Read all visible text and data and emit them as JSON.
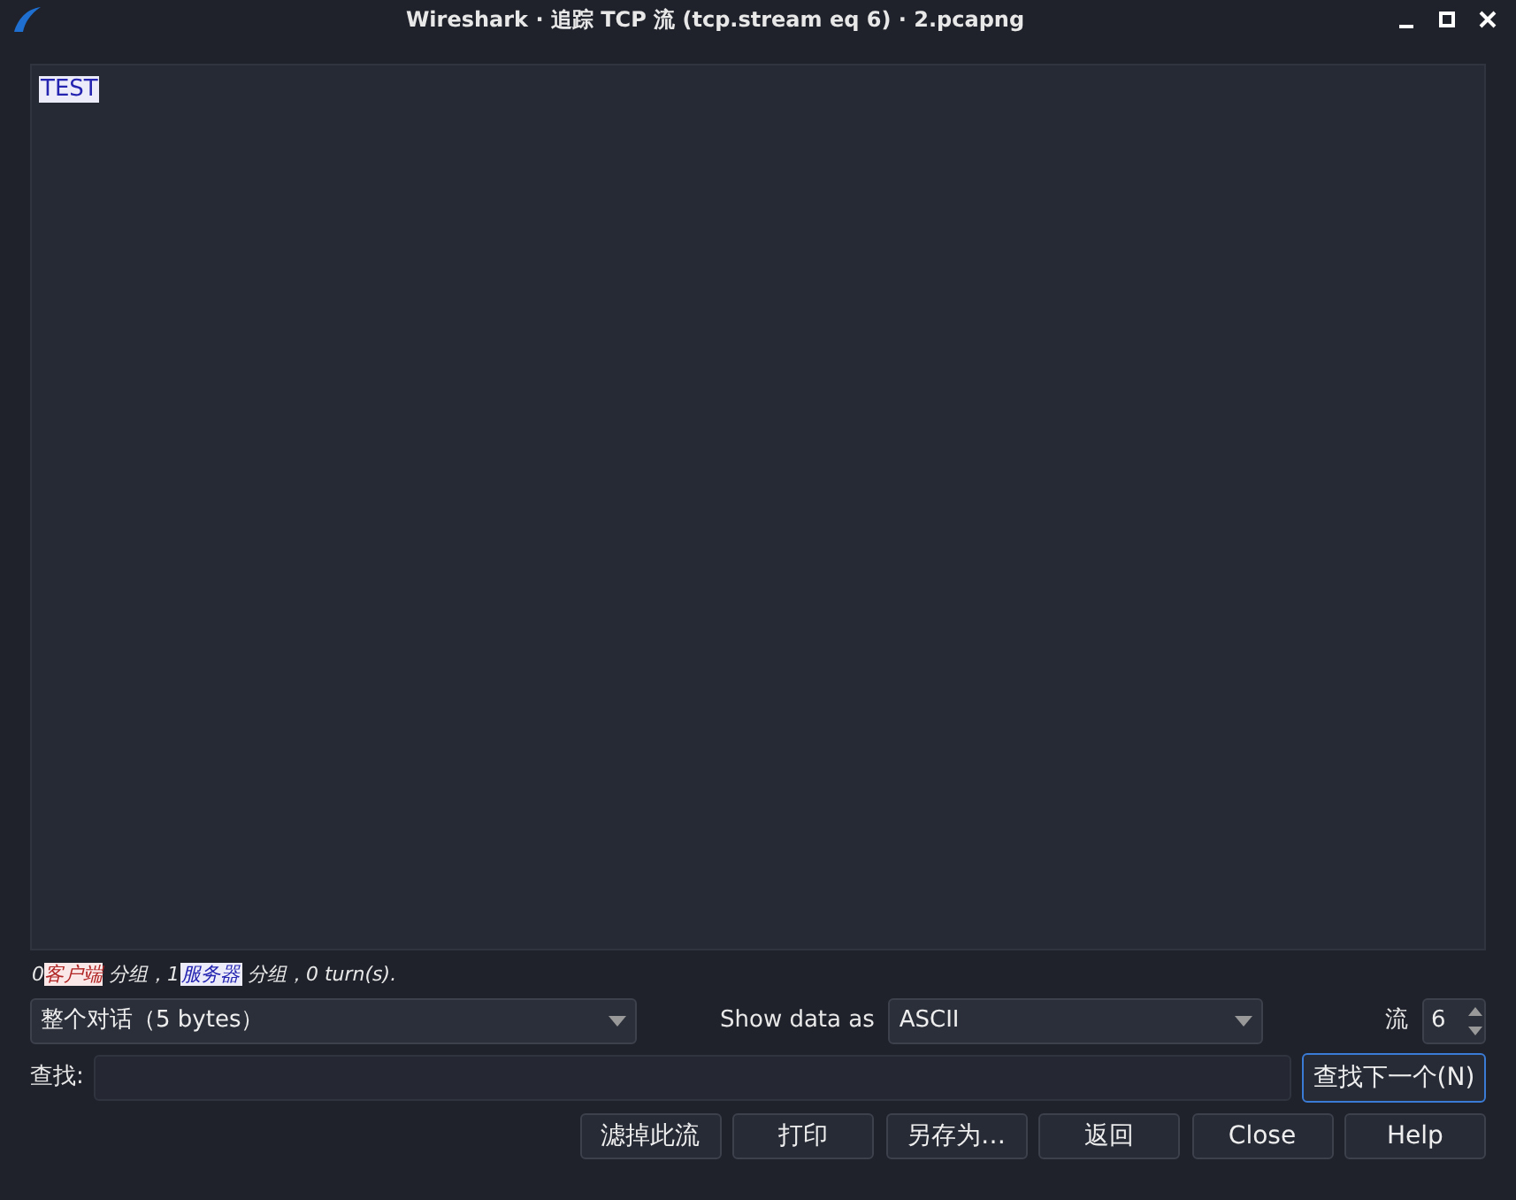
{
  "window": {
    "title": "Wireshark · 追踪 TCP 流 (tcp.stream eq 6) · 2.pcapng"
  },
  "stream_text": [
    {
      "text": "TEST",
      "kind": "server"
    }
  ],
  "stats": [
    {
      "text": "0",
      "kind": "plain"
    },
    {
      "text": "客户端",
      "kind": "client"
    },
    {
      "text": " 分组，1",
      "kind": "plain"
    },
    {
      "text": "服务器",
      "kind": "server"
    },
    {
      "text": " 分组，0 turn(s).",
      "kind": "plain"
    }
  ],
  "conversation_select": {
    "value": "整个对话（5 bytes）"
  },
  "show_data_label": "Show data as",
  "show_data_select": {
    "value": "ASCII"
  },
  "stream_label": "流",
  "stream_spin": {
    "value": "6"
  },
  "find_label": "查找:",
  "find_next_button": {
    "label": "查找下一个(N)",
    "focused": true
  },
  "buttons": [
    {
      "label": "滤掉此流"
    },
    {
      "label": "打印"
    },
    {
      "label": "另存为…"
    },
    {
      "label": "返回"
    },
    {
      "label": "Close"
    },
    {
      "label": "Help"
    }
  ]
}
